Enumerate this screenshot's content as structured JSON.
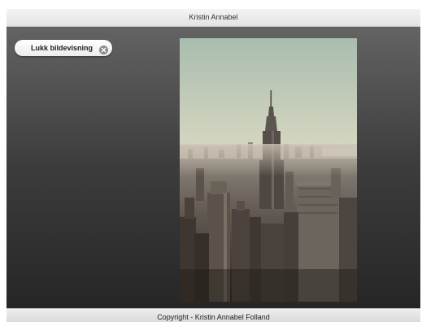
{
  "header": {
    "title": "Kristin Annabel"
  },
  "viewer": {
    "close_button": {
      "label": "Lukk bildevisning",
      "icon": "close-circle-icon"
    },
    "photo": {
      "alt": ""
    }
  },
  "footer": {
    "copyright": "Copyright - Kristin Annabel Folland"
  },
  "colors": {
    "header_bg": "#eaeaea",
    "viewer_top": "#636363",
    "viewer_bottom": "#262626",
    "button_bg": "#ffffff",
    "icon_gray": "#8a8a8a"
  }
}
